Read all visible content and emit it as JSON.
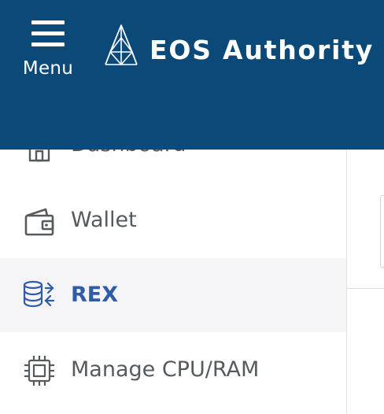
{
  "header": {
    "menu_label": "Menu",
    "brand_name": "EOS Authority",
    "background_color": "#0b4a78"
  },
  "sidebar": {
    "items": [
      {
        "label": "Dashboard",
        "icon": "home-icon",
        "active": false
      },
      {
        "label": "Wallet",
        "icon": "wallet-icon",
        "active": false
      },
      {
        "label": "REX",
        "icon": "rex-coins-icon",
        "active": true
      },
      {
        "label": "Manage CPU/RAM",
        "icon": "cpu-chip-icon",
        "active": false
      }
    ],
    "active_color": "#2f5ca8",
    "text_color": "#555a5f"
  }
}
